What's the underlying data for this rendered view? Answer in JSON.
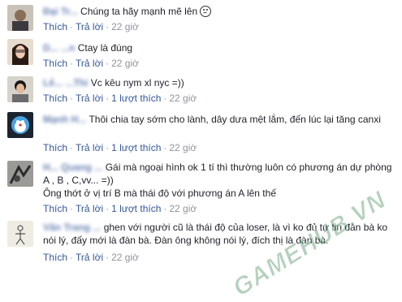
{
  "comments": [
    {
      "name": "Đại Tr...",
      "text": "Chúng ta hãy mạnh mẽ lên",
      "has_emoji": true,
      "emoji": "frown-emoji",
      "like_label": "Thích",
      "reply_label": "Trả lời",
      "likes": "",
      "time": "22 giờ"
    },
    {
      "name": "D... ...n",
      "text": "Ctay là đúng",
      "like_label": "Thích",
      "reply_label": "Trả lời",
      "likes": "",
      "time": "22 giờ"
    },
    {
      "name": "Lê... ...Thi",
      "text": "Vc kêu nym xl nyc =))",
      "like_label": "Thích",
      "reply_label": "Trả lời",
      "likes": "1 lượt thích",
      "time": "22 giờ"
    },
    {
      "name": "Mạnh H...",
      "text": "Thôi chia tay sớm cho lành, dây dưa mệt lắm, đến lúc lại tăng canxi",
      "like_label": "Thích",
      "reply_label": "Trả lời",
      "likes": "1 lượt thích",
      "time": "22 giờ"
    },
    {
      "name": "H... Quang ...",
      "text": "Gái mà ngoại hình ok 1 tí thì thường luôn có phương án dự phòng A , B , C,vv... =))",
      "text2": "Ông thớt ở vị trí B mà thái độ với phương án A lên thế",
      "like_label": "Thích",
      "reply_label": "Trả lời",
      "likes": "1 lượt thích",
      "time": "22 giờ"
    },
    {
      "name": "Văn Trang ...",
      "text": "ghen với người cũ là thái độ của loser, là vì ko đủ tự tin đàn bà ko nói lý, đấy mới là đàn bà. Đàn ông không nói lý, đích thị là đàn bà.",
      "like_label": "Thích",
      "reply_label": "Trả lời",
      "likes": "",
      "time": "22 giờ"
    }
  ],
  "watermark": "GAMEHUB.VN",
  "colors": {
    "link": "#365899",
    "meta": "#90949c",
    "text": "#1d2129"
  }
}
